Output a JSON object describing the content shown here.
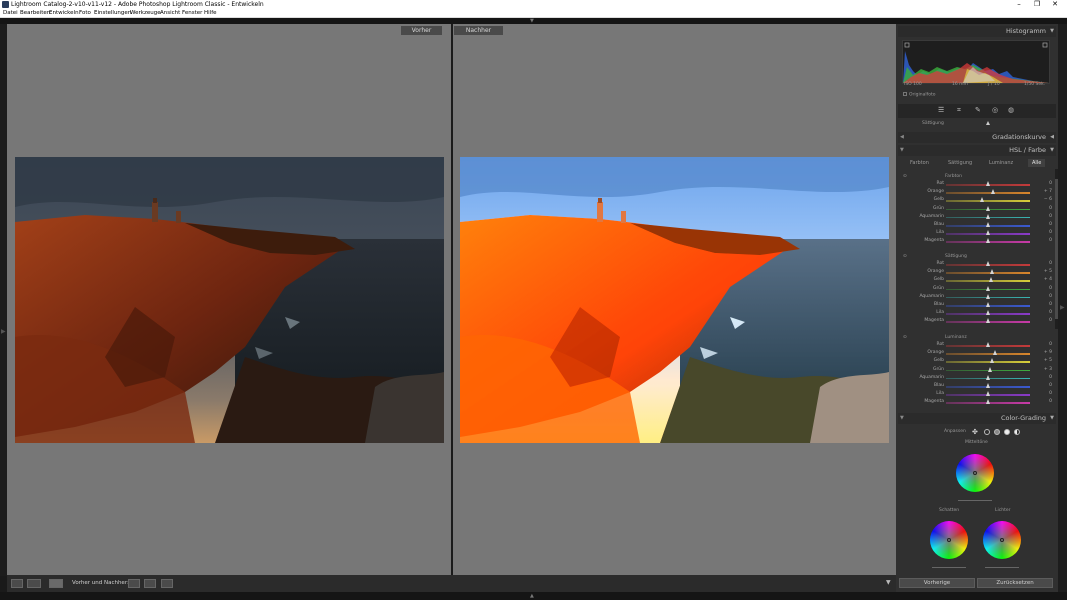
{
  "window": {
    "title": "Lightroom Catalog-2-v10-v11-v12 - Adobe Photoshop Lightroom Classic - Entwickeln",
    "minimize": "–",
    "maximize": "❐",
    "close": "✕"
  },
  "menu": [
    "Datei",
    "Bearbeiten",
    "Entwickeln",
    "Foto",
    "Einstellungen",
    "Werkzeuge",
    "Ansicht",
    "Fenster",
    "Hilfe"
  ],
  "view": {
    "before_label": "Vorher",
    "after_label": "Nachher"
  },
  "toolbar": {
    "mode_label": "Vorher und Nachher:"
  },
  "right_panel": {
    "histogram_title": "Histogramm",
    "histogram_info": [
      "ISO 100",
      "16 mm",
      "ƒ / 10",
      "1/50 Sek."
    ],
    "original_photo_label": "Originalfoto",
    "saturation_partial_label": "Sättigung",
    "tone_curve_title": "Gradationskurve",
    "hsl_title": "HSL / Farbe",
    "hsl_tabs": [
      "Farbton",
      "Sättigung",
      "Luminanz",
      "Alle"
    ],
    "active_tab": "Alle",
    "groups": [
      {
        "title": "Farbton",
        "rows": [
          {
            "label": "Rot",
            "value": "0",
            "level": 0
          },
          {
            "label": "Orange",
            "value": "+ 7",
            "level": 7
          },
          {
            "label": "Gelb",
            "value": "− 6",
            "level": -6
          },
          {
            "label": "Grün",
            "value": "0",
            "level": 0
          },
          {
            "label": "Aquamarin",
            "value": "0",
            "level": 0
          },
          {
            "label": "Blau",
            "value": "0",
            "level": 0
          },
          {
            "label": "Lila",
            "value": "0",
            "level": 0
          },
          {
            "label": "Magenta",
            "value": "0",
            "level": 0
          }
        ]
      },
      {
        "title": "Sättigung",
        "rows": [
          {
            "label": "Rot",
            "value": "0",
            "level": 0
          },
          {
            "label": "Orange",
            "value": "+ 5",
            "level": 5
          },
          {
            "label": "Gelb",
            "value": "+ 4",
            "level": 4
          },
          {
            "label": "Grün",
            "value": "0",
            "level": 0
          },
          {
            "label": "Aquamarin",
            "value": "0",
            "level": 0
          },
          {
            "label": "Blau",
            "value": "0",
            "level": 0
          },
          {
            "label": "Lila",
            "value": "0",
            "level": 0
          },
          {
            "label": "Magenta",
            "value": "0",
            "level": 0
          }
        ]
      },
      {
        "title": "Luminanz",
        "rows": [
          {
            "label": "Rot",
            "value": "0",
            "level": 0
          },
          {
            "label": "Orange",
            "value": "+ 9",
            "level": 9
          },
          {
            "label": "Gelb",
            "value": "+ 5",
            "level": 5
          },
          {
            "label": "Grün",
            "value": "+ 3",
            "level": 3
          },
          {
            "label": "Aquamarin",
            "value": "0",
            "level": 0
          },
          {
            "label": "Blau",
            "value": "0",
            "level": 0
          },
          {
            "label": "Lila",
            "value": "0",
            "level": 0
          },
          {
            "label": "Magenta",
            "value": "0",
            "level": 0
          }
        ]
      }
    ],
    "color_grading_title": "Color-Grading",
    "adjust_label": "Anpassen",
    "midtones_label": "Mitteltöne",
    "shadows_label": "Schatten",
    "highlights_label": "Lichter",
    "prev_button": "Vorherige",
    "reset_button": "Zurücksetzen"
  },
  "colors": {
    "slider_tracks": [
      "#c43a3a",
      "#d8862c",
      "#d8cf3a",
      "#3fae3f",
      "#39b5b2",
      "#3a5ad0",
      "#8a3ac9",
      "#c93aa8"
    ]
  }
}
